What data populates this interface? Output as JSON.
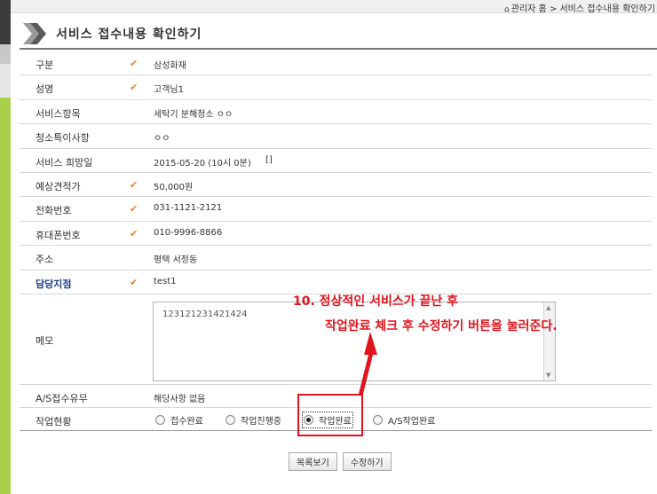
{
  "breadcrumb": {
    "home": "관리자 홈",
    "current": "서비스 접수내용 확인하기"
  },
  "page": {
    "title": "서비스 접수내용 확인하기"
  },
  "fields": [
    {
      "label": "구분",
      "value": "삼성화재",
      "checked": true
    },
    {
      "label": "성명",
      "value": "고객님1",
      "checked": true
    },
    {
      "label": "서비스항목",
      "value": "세탁기 분해청소 ㅇㅇ",
      "checked": false
    },
    {
      "label": "청소특이사항",
      "value": "ㅇㅇ",
      "checked": false
    },
    {
      "label": "서비스 희망일",
      "value": "2015-05-20 (10시 0분)",
      "extra": "[]",
      "checked": false
    },
    {
      "label": "예상견적가",
      "value": "50,000원",
      "checked": true
    },
    {
      "label": "전화번호",
      "value": "031-1121-2121",
      "checked": true
    },
    {
      "label": "휴대폰번호",
      "value": "010-9996-8866",
      "checked": true
    },
    {
      "label": "주소",
      "value": "평택 서정동",
      "checked": false
    },
    {
      "label": "담당지점",
      "value": "test1",
      "checked": true
    }
  ],
  "memo": {
    "label": "메모",
    "value": "123121231421424"
  },
  "as_reception": {
    "label": "A/S접수유무",
    "value": "해당사항 없음"
  },
  "work_status": {
    "label": "작업현황",
    "options": [
      "접수완료",
      "작업진행중",
      "작업완료",
      "A/S작업완료"
    ],
    "selected": "작업완료"
  },
  "annotation": {
    "line1": "10. 정상적인 서비스가 끝난 후",
    "line2": "작업완료 체크 후 수정하기 버튼을 눌러준다."
  },
  "buttons": {
    "list": "목록보기",
    "edit": "수정하기"
  },
  "colors": {
    "check": "#e8832a",
    "annotation": "#e0141e",
    "accent_green": "#a9cf4c"
  },
  "icons": {
    "check": "✔",
    "home": "home-icon"
  }
}
